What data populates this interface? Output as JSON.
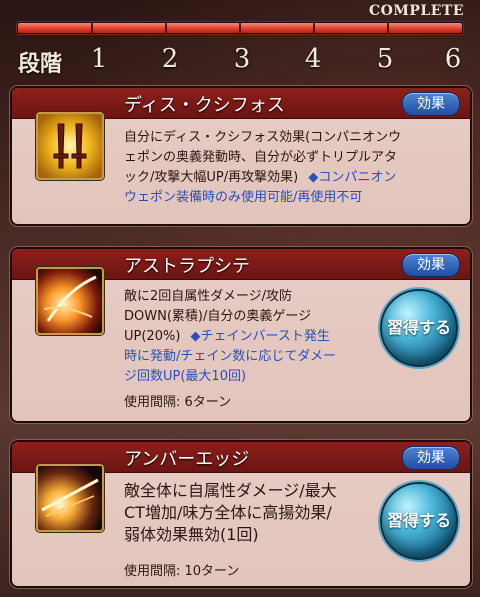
{
  "header": {
    "complete_label": "COMPLETE",
    "stage_label": "段階",
    "stages": [
      "1",
      "2",
      "3",
      "4",
      "5",
      "6"
    ],
    "progress": 1.0
  },
  "skills": [
    {
      "title": "ディス・クシフォス",
      "effect_label": "効果",
      "description_lines": [
        "自分にディス・クシフォス効果(コンパニオンウ",
        "ェポンの奥義発動時、自分が必ずトリプルアタ",
        "ック/攻撃大幅UP/再攻撃効果)"
      ],
      "note_lines": [
        "◆コンパニオン",
        "ウェポン装備時のみ使用可能/再使用不可"
      ],
      "icon": "twin-swords-icon"
    },
    {
      "title": "アストラプシテ",
      "effect_label": "効果",
      "description_lines": [
        "敵に2回自属性ダメージ/攻防",
        "DOWN(累積)/自分の奥義ゲージ",
        "UP(20%)"
      ],
      "note_lines": [
        "◆チェインバースト発生",
        "時に発動/チェイン数に応じてダメー",
        "ジ回数UP(最大10回)"
      ],
      "cooldown": "使用間隔: 6ターン",
      "learn_label": "習得する",
      "icon": "lightning-slash-icon"
    },
    {
      "title": "アンバーエッジ",
      "effect_label": "効果",
      "description_lines": [
        "敵全体に自属性ダメージ/最大",
        "CT増加/味方全体に高揚効果/",
        "弱体効果無効(1回)"
      ],
      "cooldown": "使用間隔: 10ターン",
      "learn_label": "習得する",
      "icon": "amber-blade-icon"
    }
  ],
  "colors": {
    "header_red": "#8d1f1b",
    "card_bg": "#e5c9c1",
    "note_blue": "#2a4fb8",
    "button_blue": "#2b5fb8",
    "learn_cyan": "#3aa7cf"
  }
}
